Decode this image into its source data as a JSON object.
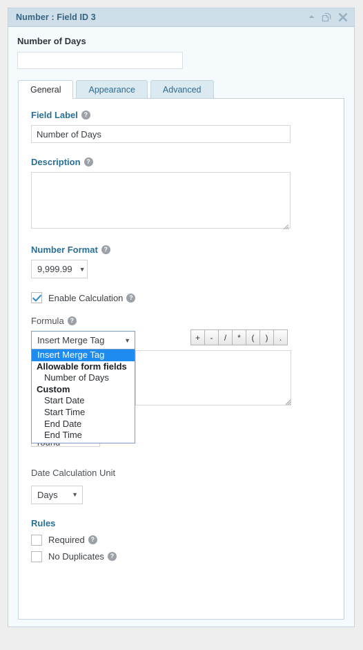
{
  "header": {
    "title": "Number : Field ID 3",
    "icons": [
      {
        "name": "collapse-icon",
        "glyph": "▲"
      },
      {
        "name": "duplicate-icon",
        "glyph": "⧉"
      },
      {
        "name": "close-icon",
        "glyph": "✖"
      }
    ]
  },
  "preview": {
    "label": "Number of Days",
    "value": "",
    "placeholder": ""
  },
  "tabs": [
    {
      "label": "General",
      "active": true
    },
    {
      "label": "Appearance",
      "active": false
    },
    {
      "label": "Advanced",
      "active": false
    }
  ],
  "general": {
    "field_label": {
      "label": "Field Label",
      "value": "Number of Days",
      "help": "?"
    },
    "description": {
      "label": "Description",
      "value": "",
      "help": "?"
    },
    "number_format": {
      "label": "Number Format",
      "value": "9,999.99",
      "help": "?",
      "caret": "▼"
    },
    "enable_calculation": {
      "label": "Enable Calculation",
      "checked": true,
      "help": "?"
    },
    "formula": {
      "label": "Formula",
      "help": "?",
      "merge_tag_value": "Insert Merge Tag",
      "caret": "▼",
      "value": "",
      "operators": [
        "+",
        "-",
        "/",
        "*",
        "(",
        ")",
        "."
      ],
      "dropdown_options": [
        {
          "label": "Insert Merge Tag",
          "type": "option",
          "selected": true
        },
        {
          "label": "Allowable form fields",
          "type": "group"
        },
        {
          "label": "Number of Days",
          "type": "child"
        },
        {
          "label": "Custom",
          "type": "group"
        },
        {
          "label": "Start Date",
          "type": "child"
        },
        {
          "label": "Start Time",
          "type": "child"
        },
        {
          "label": "End Date",
          "type": "child"
        },
        {
          "label": "End Time",
          "type": "child"
        }
      ]
    },
    "rounding": {
      "value": "Do not round",
      "caret": "▼"
    },
    "date_calculation_unit": {
      "label": "Date Calculation Unit",
      "value": "Days",
      "caret": "▼"
    },
    "rules": {
      "label": "Rules",
      "items": [
        {
          "label": "Required",
          "checked": false,
          "help": "?"
        },
        {
          "label": "No Duplicates",
          "checked": false,
          "help": "?"
        }
      ]
    }
  },
  "colors": {
    "header_bg": "#cfdfea",
    "header_text": "#36637f",
    "panel_bg": "#f5fafd",
    "accent_label": "#2a6f94",
    "dropdown_highlight": "#1e8bf0",
    "checkbox_check": "#2e87c9"
  }
}
